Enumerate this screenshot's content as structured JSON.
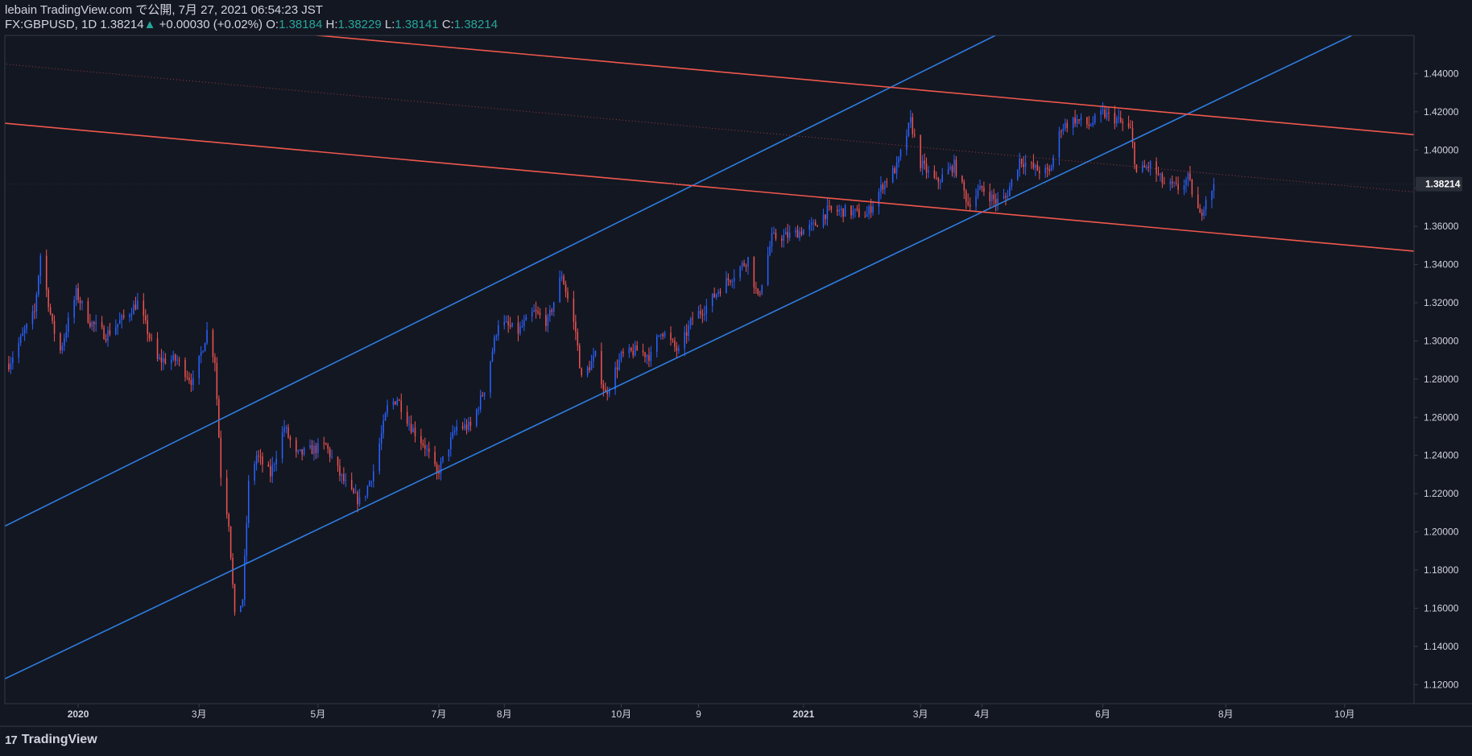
{
  "header": {
    "published": "lebain TradingView.com で公開, 7月 27, 2021 06:54:23 JST",
    "symbol": "FX:GBPUSD, 1D 1.38214",
    "change_arrow": "▲",
    "change": "+0.00030 (+0.02%)",
    "open_label": "O:",
    "open": "1.38184",
    "high_label": "H:",
    "high": "1.38229",
    "low_label": "L:",
    "low": "1.38141",
    "close_label": "C:",
    "close": "1.38214"
  },
  "footer": {
    "logo_text": "TradingView",
    "logo_icon": "tradingview-logo-icon"
  },
  "colors": {
    "background": "#131722",
    "up": "#2962ff",
    "down": "#ef5350",
    "channel": "#2f7de1",
    "resistance": "#f0584c",
    "text": "#d1d4dc",
    "axis_line": "#363a45"
  },
  "chart_data": {
    "type": "candlestick",
    "symbol": "FX:GBPUSD",
    "interval": "1D",
    "last_price": 1.38214,
    "last_price_label": "1.38214",
    "x_range": [
      "2019-11-25",
      "2021-11-05"
    ],
    "ylim": [
      1.11,
      1.46
    ],
    "y_ticks": [
      "1.12000",
      "1.14000",
      "1.16000",
      "1.18000",
      "1.20000",
      "1.22000",
      "1.24000",
      "1.26000",
      "1.28000",
      "1.30000",
      "1.32000",
      "1.34000",
      "1.36000",
      "1.38000",
      "1.40000",
      "1.42000",
      "1.44000"
    ],
    "x_ticks": [
      {
        "label": "2020",
        "date": "2020-01-01",
        "bold": true
      },
      {
        "label": "3月",
        "date": "2020-03-02"
      },
      {
        "label": "5月",
        "date": "2020-05-01"
      },
      {
        "label": "7月",
        "date": "2020-07-01"
      },
      {
        "label": "8月",
        "date": "2020-08-03"
      },
      {
        "label": "10月",
        "date": "2020-10-01"
      },
      {
        "label": "9",
        "date": "2020-11-09"
      },
      {
        "label": "2021",
        "date": "2021-01-01",
        "bold": true
      },
      {
        "label": "3月",
        "date": "2021-03-01"
      },
      {
        "label": "4月",
        "date": "2021-04-01"
      },
      {
        "label": "6月",
        "date": "2021-06-01"
      },
      {
        "label": "8月",
        "date": "2021-08-02"
      },
      {
        "label": "10月",
        "date": "2021-10-01"
      }
    ],
    "price_path": [
      [
        "2019-11-27",
        1.288
      ],
      [
        "2019-12-05",
        1.305
      ],
      [
        "2019-12-10",
        1.315
      ],
      [
        "2019-12-13",
        1.345
      ],
      [
        "2019-12-19",
        1.308
      ],
      [
        "2019-12-23",
        1.295
      ],
      [
        "2019-12-31",
        1.325
      ],
      [
        "2020-01-07",
        1.31
      ],
      [
        "2020-01-15",
        1.303
      ],
      [
        "2020-01-24",
        1.312
      ],
      [
        "2020-01-31",
        1.32
      ],
      [
        "2020-02-10",
        1.29
      ],
      [
        "2020-02-20",
        1.29
      ],
      [
        "2020-02-28",
        1.278
      ],
      [
        "2020-03-06",
        1.305
      ],
      [
        "2020-03-10",
        1.29
      ],
      [
        "2020-03-13",
        1.23
      ],
      [
        "2020-03-17",
        1.205
      ],
      [
        "2020-03-20",
        1.155
      ],
      [
        "2020-03-24",
        1.165
      ],
      [
        "2020-03-27",
        1.225
      ],
      [
        "2020-03-31",
        1.24
      ],
      [
        "2020-04-07",
        1.23
      ],
      [
        "2020-04-14",
        1.255
      ],
      [
        "2020-04-20",
        1.24
      ],
      [
        "2020-04-28",
        1.243
      ],
      [
        "2020-05-05",
        1.245
      ],
      [
        "2020-05-12",
        1.23
      ],
      [
        "2020-05-18",
        1.22
      ],
      [
        "2020-05-23",
        1.215
      ],
      [
        "2020-05-29",
        1.232
      ],
      [
        "2020-06-05",
        1.265
      ],
      [
        "2020-06-10",
        1.27
      ],
      [
        "2020-06-17",
        1.255
      ],
      [
        "2020-06-24",
        1.245
      ],
      [
        "2020-06-30",
        1.23
      ],
      [
        "2020-07-10",
        1.255
      ],
      [
        "2020-07-17",
        1.255
      ],
      [
        "2020-07-24",
        1.275
      ],
      [
        "2020-07-31",
        1.31
      ],
      [
        "2020-08-10",
        1.305
      ],
      [
        "2020-08-18",
        1.315
      ],
      [
        "2020-08-25",
        1.31
      ],
      [
        "2020-09-01",
        1.335
      ],
      [
        "2020-09-08",
        1.305
      ],
      [
        "2020-09-11",
        1.28
      ],
      [
        "2020-09-18",
        1.292
      ],
      [
        "2020-09-23",
        1.272
      ],
      [
        "2020-10-01",
        1.292
      ],
      [
        "2020-10-09",
        1.295
      ],
      [
        "2020-10-16",
        1.292
      ],
      [
        "2020-10-21",
        1.306
      ],
      [
        "2020-10-30",
        1.294
      ],
      [
        "2020-11-06",
        1.312
      ],
      [
        "2020-11-13",
        1.318
      ],
      [
        "2020-11-20",
        1.328
      ],
      [
        "2020-11-27",
        1.335
      ],
      [
        "2020-12-04",
        1.343
      ],
      [
        "2020-12-09",
        1.322
      ],
      [
        "2020-12-16",
        1.354
      ],
      [
        "2020-12-24",
        1.355
      ],
      [
        "2021-01-06",
        1.36
      ],
      [
        "2021-01-13",
        1.368
      ],
      [
        "2021-01-22",
        1.368
      ],
      [
        "2021-02-02",
        1.366
      ],
      [
        "2021-02-10",
        1.382
      ],
      [
        "2021-02-17",
        1.391
      ],
      [
        "2021-02-24",
        1.415
      ],
      [
        "2021-03-01",
        1.393
      ],
      [
        "2021-03-09",
        1.383
      ],
      [
        "2021-03-18",
        1.392
      ],
      [
        "2021-03-25",
        1.372
      ],
      [
        "2021-04-01",
        1.38
      ],
      [
        "2021-04-08",
        1.373
      ],
      [
        "2021-04-13",
        1.375
      ],
      [
        "2021-04-20",
        1.395
      ],
      [
        "2021-04-28",
        1.39
      ],
      [
        "2021-05-05",
        1.388
      ],
      [
        "2021-05-11",
        1.412
      ],
      [
        "2021-05-18",
        1.416
      ],
      [
        "2021-05-25",
        1.413
      ],
      [
        "2021-06-01",
        1.419
      ],
      [
        "2021-06-08",
        1.416
      ],
      [
        "2021-06-15",
        1.41
      ],
      [
        "2021-06-18",
        1.388
      ],
      [
        "2021-06-25",
        1.392
      ],
      [
        "2021-07-02",
        1.382
      ],
      [
        "2021-07-09",
        1.38
      ],
      [
        "2021-07-14",
        1.385
      ],
      [
        "2021-07-20",
        1.365
      ],
      [
        "2021-07-23",
        1.375
      ],
      [
        "2021-07-27",
        1.38214
      ]
    ],
    "trend_lines": [
      {
        "name": "channel-upper",
        "color": "#2f7de1",
        "points": [
          [
            "2019-11-25",
            1.203
          ],
          [
            "2021-01-20",
            1.42
          ]
        ]
      },
      {
        "name": "channel-lower",
        "color": "#2f7de1",
        "points": [
          [
            "2019-11-25",
            1.123
          ],
          [
            "2021-03-17",
            1.36
          ]
        ]
      },
      {
        "name": "resistance-upper",
        "color": "#f0584c",
        "points": [
          [
            "2020-05-01",
            1.46
          ],
          [
            "2021-11-05",
            1.408
          ]
        ]
      },
      {
        "name": "resistance-lower",
        "color": "#f0584c",
        "points": [
          [
            "2019-11-25",
            1.414
          ],
          [
            "2021-11-05",
            1.347
          ]
        ]
      },
      {
        "name": "dotted-trend",
        "color": "#f0584c",
        "dotted": true,
        "points": [
          [
            "2019-11-25",
            1.445
          ],
          [
            "2021-11-05",
            1.378
          ]
        ]
      }
    ]
  }
}
